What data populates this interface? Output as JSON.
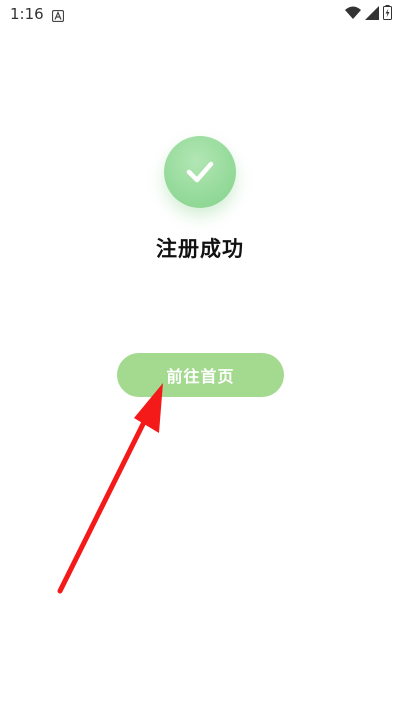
{
  "status_bar": {
    "time": "1:16",
    "icons": [
      "notification-a-icon",
      "wifi-icon",
      "signal-icon",
      "battery-icon"
    ]
  },
  "success": {
    "icon": "checkmark-icon",
    "title": "注册成功"
  },
  "actions": {
    "go_home_label": "前往首页"
  },
  "annotation": {
    "arrow_color": "#f41a1a"
  },
  "colors": {
    "accent_green": "#a4da90",
    "icon_green": "#95da9a"
  }
}
